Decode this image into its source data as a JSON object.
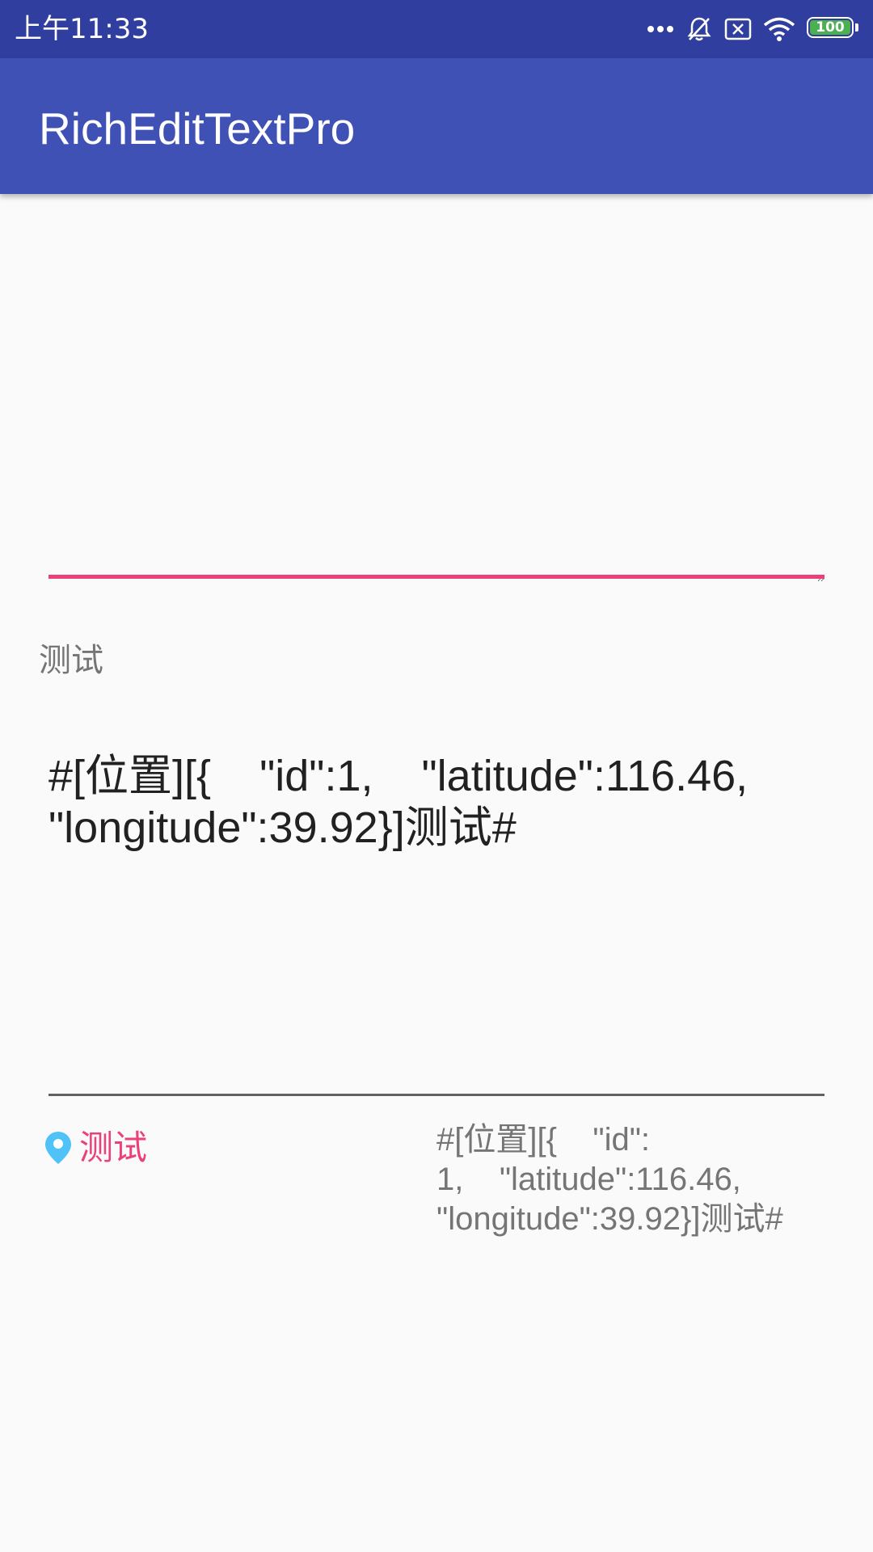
{
  "status_bar": {
    "time": "上午11:33",
    "icons": [
      "more-dots-icon",
      "bell-off-icon",
      "sim-x-icon",
      "wifi-icon",
      "battery-icon"
    ],
    "battery_level": "100",
    "bar_color": "#303f9f",
    "battery_color": "#4caf50"
  },
  "app_bar": {
    "title": "RichEditTextPro",
    "color": "#3f51b5"
  },
  "editor": {
    "value": "",
    "accent_color": "#ec407a"
  },
  "label": {
    "text": "测试"
  },
  "raw_text": {
    "line1": "#[位置][{    \"id\":1,    \"latitude\":116.46,",
    "line2": "\"longitude\":39.92}]测试#"
  },
  "rich_view": {
    "icon": "location-pin-icon",
    "label": "测试",
    "color": "#ec407a",
    "icon_color": "#4fc3f7"
  },
  "source_text": {
    "line1": "#[位置][{    \"id\":",
    "line2": "1,    \"latitude\":116.46,",
    "line3": "\"longitude\":39.92}]测试#"
  }
}
